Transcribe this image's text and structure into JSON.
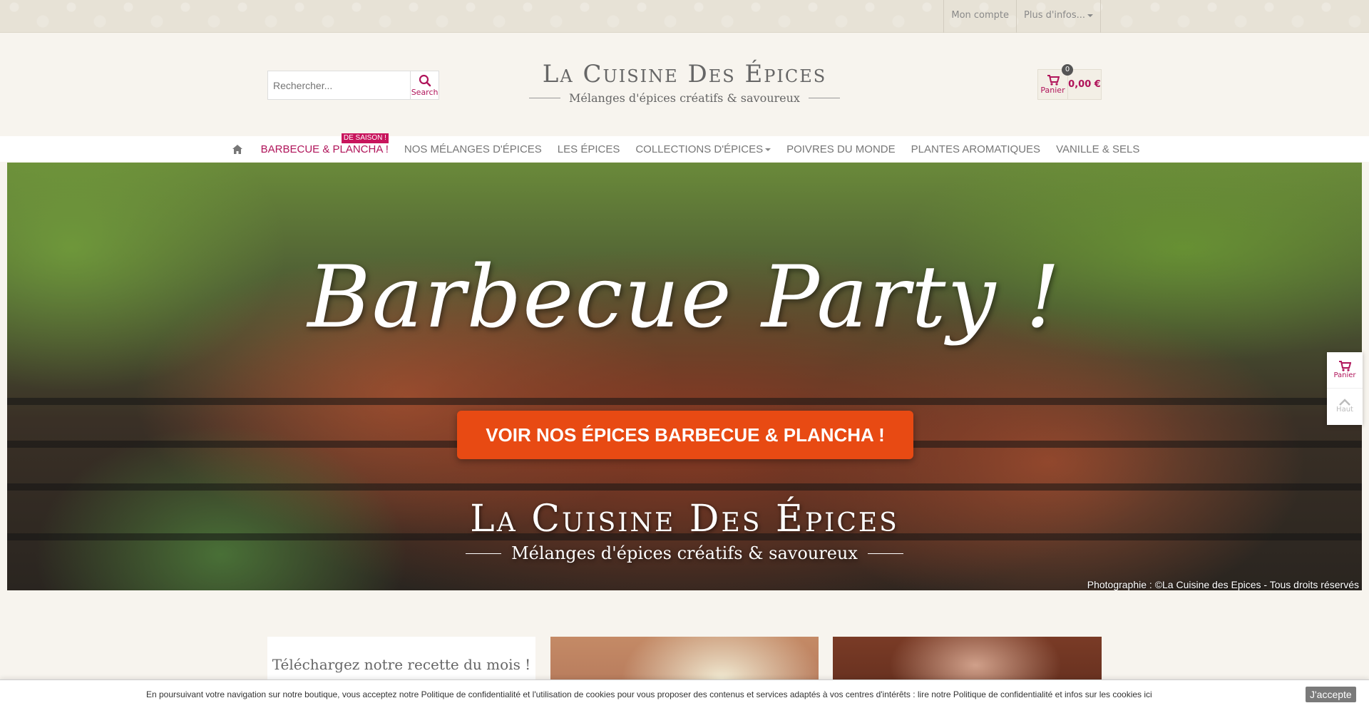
{
  "topbar": {
    "account_label": "Mon compte",
    "more_label": "Plus d'infos..."
  },
  "header": {
    "search_placeholder": "Rechercher...",
    "search_button_label": "Search",
    "logo_title": "La Cuisine Des Épices",
    "logo_subtitle": "Mélanges d'épices créatifs & savoureux",
    "cart_label": "Panier",
    "cart_count": "0",
    "cart_total": "0,00 €"
  },
  "nav": {
    "home_icon": "home-icon",
    "items": [
      {
        "label": "BARBECUE & PLANCHA !",
        "badge": "DE SAISON !"
      },
      {
        "label": "NOS MÉLANGES D'ÉPICES"
      },
      {
        "label": "LES ÉPICES"
      },
      {
        "label": "COLLECTIONS D'ÉPICES"
      },
      {
        "label": "POIVRES DU MONDE"
      },
      {
        "label": "PLANTES AROMATIQUES"
      },
      {
        "label": "VANILLE & SELS"
      }
    ]
  },
  "hero": {
    "title": "Barbecue Party !",
    "cta_label": "VOIR NOS ÉPICES BARBECUE & PLANCHA !",
    "logo_title": "La Cuisine Des Épices",
    "logo_subtitle": "Mélanges d'épices créatifs & savoureux",
    "credit": "Photographie : ©La Cuisine des Epices - Tous droits réservés"
  },
  "side_widget": {
    "cart_label": "Panier",
    "top_label": "Haut"
  },
  "cards": {
    "recipe_title": "Téléchargez notre recette du mois !"
  },
  "cookie": {
    "text": "En poursuivant votre navigation sur notre boutique, vous acceptez notre Politique de confidentialité et l'utilisation de cookies pour vous proposer des contenus et services adaptés à vos centres d'intérêts : lire notre Politique de confidentialité et infos sur les cookies ici",
    "accept_label": "J'accepte"
  },
  "colors": {
    "accent": "#b0145a",
    "cta": "#e84a13",
    "badge": "#c8145c"
  }
}
